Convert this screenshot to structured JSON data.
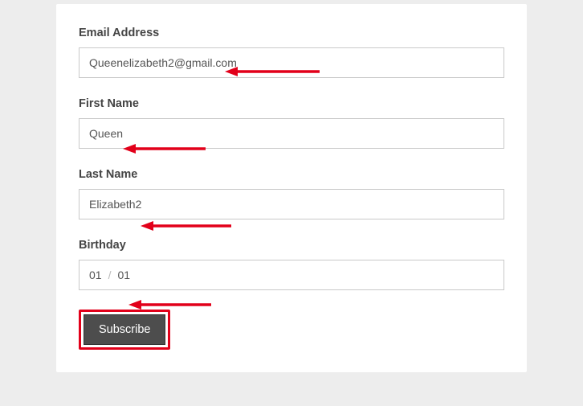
{
  "form": {
    "email": {
      "label": "Email Address",
      "value": "Queenelizabeth2@gmail.com"
    },
    "first_name": {
      "label": "First Name",
      "value": "Queen"
    },
    "last_name": {
      "label": "Last Name",
      "value": "Elizabeth2"
    },
    "birthday": {
      "label": "Birthday",
      "month": "01",
      "day": "01",
      "separator": "/"
    },
    "submit_label": "Subscribe"
  },
  "annotation": {
    "highlight_color": "#e2001a"
  }
}
